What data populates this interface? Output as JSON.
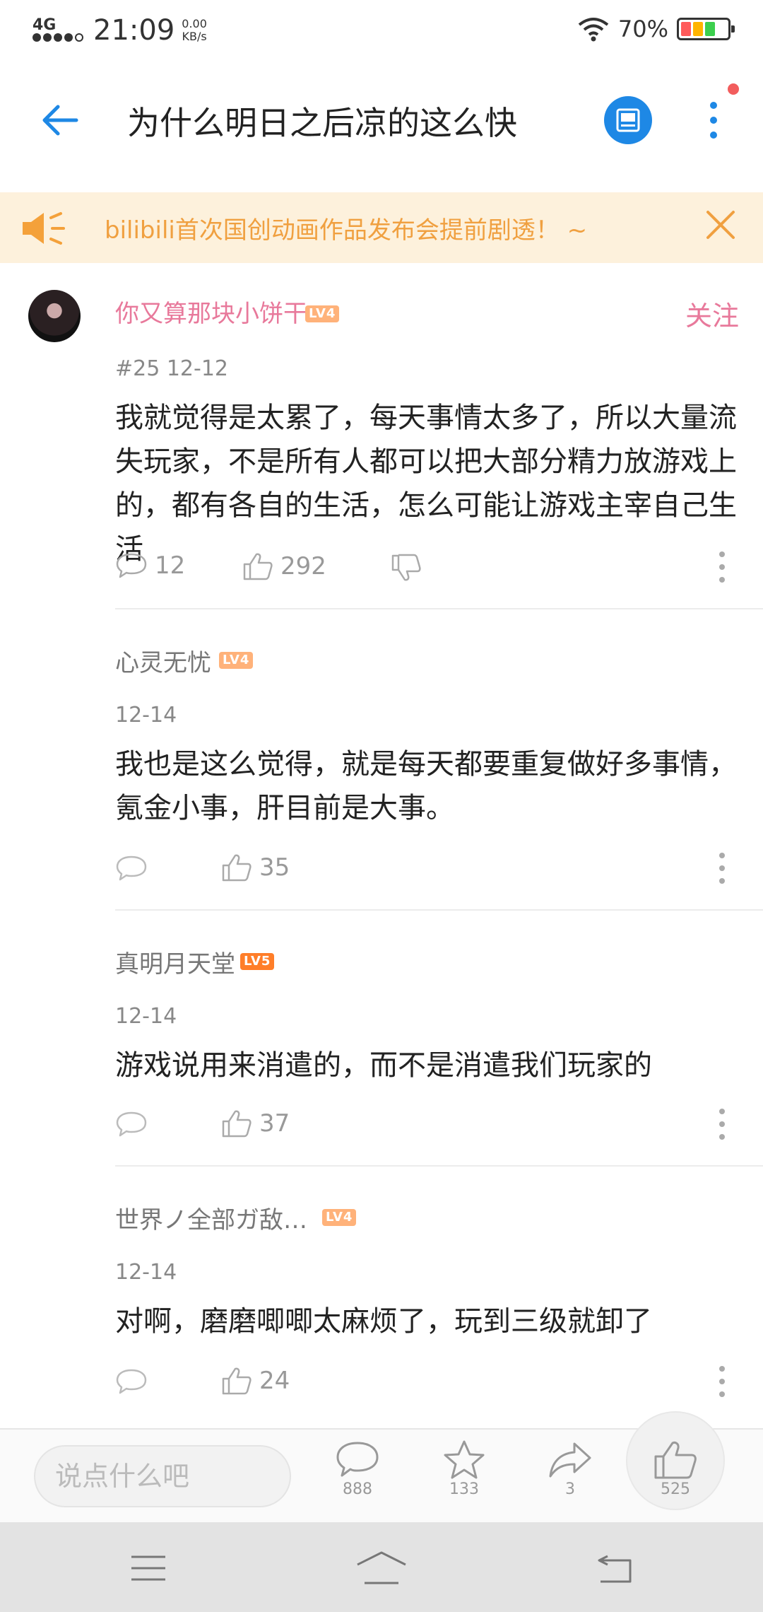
{
  "status_bar": {
    "network": "4G",
    "time": "21:09",
    "speed_value": "0.00",
    "speed_unit": "KB/s",
    "battery": "70%"
  },
  "header": {
    "title": "为什么明日之后凉的这么快",
    "back_icon": "arrow-left-icon",
    "image_icon": "image-icon",
    "more_icon": "more-vertical-icon"
  },
  "notice": {
    "text": "bilibili首次国创动画作品发布会提前剧透！ ~",
    "color": "#f0a040",
    "background": "#fdf1dc"
  },
  "main_comment": {
    "username": "你又算那块小饼干",
    "level": "LV4",
    "follow_label": "关注",
    "meta": "#25   12-12",
    "text": "我就觉得是太累了，每天事情太多了，所以大量流失玩家，不是所有人都可以把大部分精力放游戏上的，都有各自的生活，怎么可能让游戏主宰自己生活",
    "reply_count": "12",
    "like_count": "292"
  },
  "replies": [
    {
      "username": "心灵无忧",
      "level": "LV4",
      "date": "12-14",
      "text": "我也是这么觉得，就是每天都要重复做好多事情，氪金小事，肝目前是大事。",
      "like_count": "35"
    },
    {
      "username": "真明月天堂",
      "level": "LV5",
      "date": "12-14",
      "text": "游戏说用来消遣的，而不是消遣我们玩家的",
      "like_count": "37"
    },
    {
      "username": "世界ノ全部ガ敌…",
      "level": "LV4",
      "date": "12-14",
      "text": "对啊，磨磨唧唧太麻烦了，玩到三级就卸了",
      "like_count": "24"
    }
  ],
  "bottom_bar": {
    "input_placeholder": "说点什么吧",
    "comment_count": "888",
    "favorite_count": "133",
    "share_count": "3",
    "like_count": "525"
  },
  "colors": {
    "accent_blue": "#1e88e5",
    "username_pink": "#e8799b",
    "level4": "#ffb27a",
    "level5": "#ff7e29"
  }
}
